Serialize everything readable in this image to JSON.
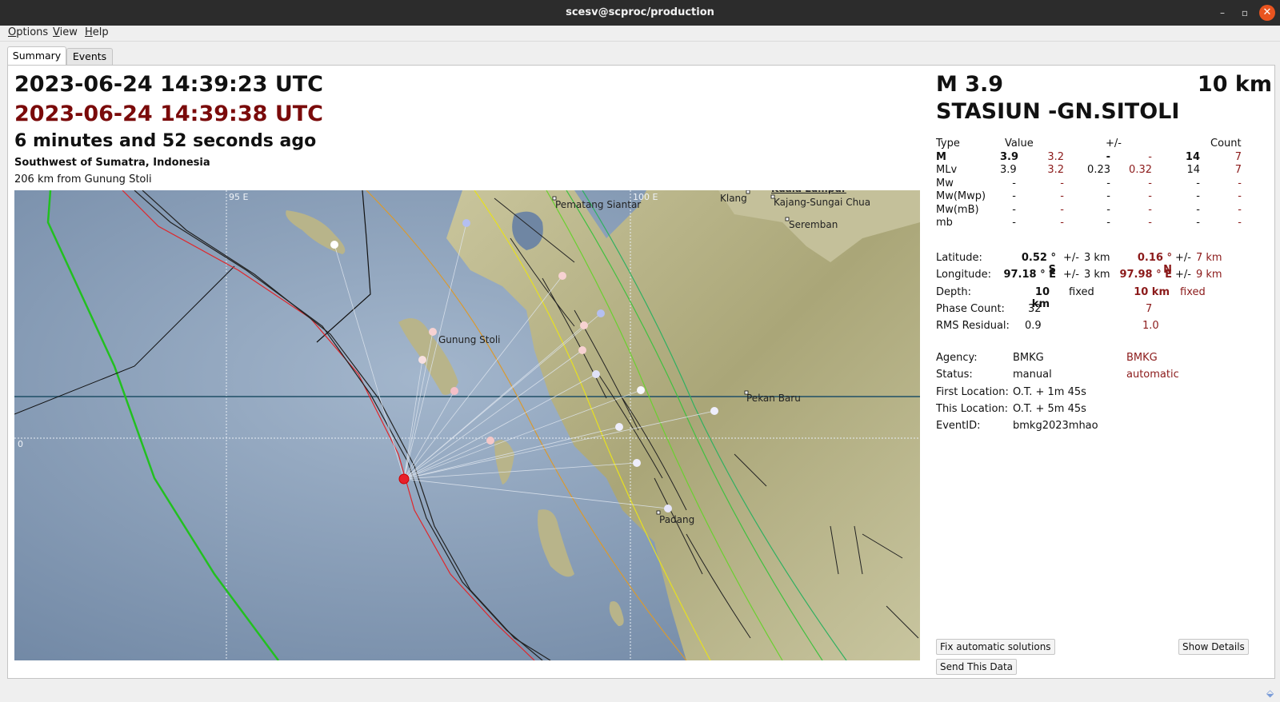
{
  "window": {
    "title": "scesv@scproc/production",
    "controls": {
      "minimize": "–",
      "maximize": "▫",
      "close": "✕"
    }
  },
  "menu": [
    "Options",
    "View",
    "Help"
  ],
  "tabs": [
    {
      "label": "Summary",
      "active": true
    },
    {
      "label": "Events",
      "active": false
    }
  ],
  "summary": {
    "origin_time": "2023-06-24 14:39:23 UTC",
    "auto_origin_time": "2023-06-24 14:39:38 UTC",
    "elapsed": "6 minutes and 52 seconds ago",
    "region": "Southwest of Sumatra, Indonesia",
    "nearest": "206 km from Gunung Stoli"
  },
  "map": {
    "grid_labels": {
      "lon_95": "95 E",
      "lon_100": "100 E",
      "lat_0": "0"
    },
    "cities": [
      "Pematang Siantar",
      "Klang",
      "Kuala Lumpur",
      "Kajang-Sungai Chua",
      "Seremban",
      "Gunung Stoli",
      "Pekan Baru",
      "Padang"
    ],
    "colors": {
      "sea": "#6f86a3",
      "land": "#b8b48a",
      "epicenter": "#e8202a",
      "trench": "#e0262a",
      "green_line": "#22c020",
      "orange_line": "#d99a30",
      "equator": "#1f4f66"
    }
  },
  "event": {
    "magnitude": "M 3.9",
    "depth": "10 km",
    "name": "STASIUN -GN.SITOLI"
  },
  "magnitudes": {
    "headers": {
      "type": "Type",
      "value": "Value",
      "err": "+/-",
      "count": "Count"
    },
    "rows": [
      {
        "type": "M",
        "v1": "3.9",
        "v2": "3.2",
        "e1": "-",
        "e2": "-",
        "n1": "14",
        "n2": "7",
        "bold": true
      },
      {
        "type": "MLv",
        "v1": "3.9",
        "v2": "3.2",
        "e1": "0.23",
        "e2": "0.32",
        "n1": "14",
        "n2": "7"
      },
      {
        "type": "Mw",
        "v1": "-",
        "v2": "-",
        "e1": "-",
        "e2": "-",
        "n1": "-",
        "n2": "-"
      },
      {
        "type": "Mw(Mwp)",
        "v1": "-",
        "v2": "-",
        "e1": "-",
        "e2": "-",
        "n1": "-",
        "n2": "-"
      },
      {
        "type": "Mw(mB)",
        "v1": "-",
        "v2": "-",
        "e1": "-",
        "e2": "-",
        "n1": "-",
        "n2": "-"
      },
      {
        "type": "mb",
        "v1": "-",
        "v2": "-",
        "e1": "-",
        "e2": "-",
        "n1": "-",
        "n2": "-"
      }
    ]
  },
  "location": {
    "latitude": {
      "label": "Latitude:",
      "v1": "0.52 ° S",
      "pm1": "+/-",
      "e1": "3 km",
      "v2": "0.16 ° N",
      "pm2": "+/-",
      "e2": "7 km"
    },
    "longitude": {
      "label": "Longitude:",
      "v1": "97.18 ° E",
      "pm1": "+/-",
      "e1": "3 km",
      "v2": "97.98 ° E",
      "pm2": "+/-",
      "e2": "9 km"
    },
    "depth": {
      "label": "Depth:",
      "v1": "10 km",
      "f1": "fixed",
      "v2": "10 km",
      "f2": "fixed"
    },
    "phase_count": {
      "label": "Phase Count:",
      "v1": "32",
      "v2": "7"
    },
    "rms": {
      "label": "RMS Residual:",
      "v1": "0.9",
      "v2": "1.0"
    }
  },
  "info": {
    "agency": {
      "label": "Agency:",
      "v1": "BMKG",
      "v2": "BMKG"
    },
    "status": {
      "label": "Status:",
      "v1": "manual",
      "v2": "automatic"
    },
    "first_location": {
      "label": "First Location:",
      "v1": "O.T. + 1m 45s"
    },
    "this_location": {
      "label": "This Location:",
      "v1": "O.T. + 5m 45s"
    },
    "event_id": {
      "label": "EventID:",
      "v1": "bmkg2023mhao"
    }
  },
  "buttons": {
    "fix": "Fix automatic solutions",
    "details": "Show Details",
    "send": "Send This Data"
  }
}
